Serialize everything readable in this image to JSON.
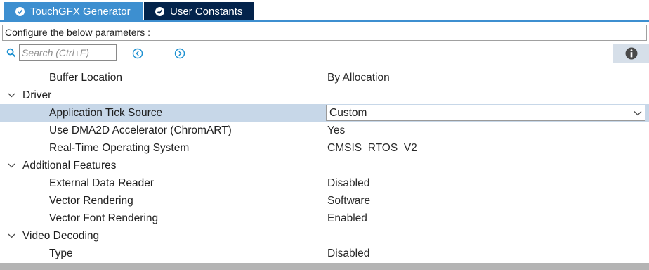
{
  "tabs": [
    {
      "label": "TouchGFX Generator",
      "icon": "check-circle-icon"
    },
    {
      "label": "User Constants",
      "icon": "check-circle-icon"
    }
  ],
  "configure_label": "Configure the below parameters :",
  "search": {
    "placeholder": "Search (Ctrl+F)",
    "value": ""
  },
  "nav": {
    "prev_icon": "circle-chevron-left-icon",
    "next_icon": "circle-chevron-right-icon"
  },
  "info_icon": "info-icon",
  "tree": {
    "buffer_location": {
      "label": "Buffer Location",
      "value": "By Allocation"
    },
    "driver": {
      "label": "Driver",
      "items": [
        {
          "label": "Application Tick Source",
          "value": "Custom"
        },
        {
          "label": "Use DMA2D Accelerator (ChromART)",
          "value": "Yes"
        },
        {
          "label": "Real-Time Operating System",
          "value": "CMSIS_RTOS_V2"
        }
      ]
    },
    "additional_features": {
      "label": "Additional Features",
      "items": [
        {
          "label": "External Data Reader",
          "value": "Disabled"
        },
        {
          "label": "Vector Rendering",
          "value": "Software"
        },
        {
          "label": "Vector Font Rendering",
          "value": "Enabled"
        }
      ]
    },
    "video_decoding": {
      "label": "Video Decoding",
      "items": [
        {
          "label": "Type",
          "value": "Disabled"
        }
      ]
    }
  },
  "colors": {
    "tab_active": "#3d8fd0",
    "tab_dark": "#03234b",
    "selected_row": "#c7d7e8",
    "accent": "#1a8fd0"
  }
}
